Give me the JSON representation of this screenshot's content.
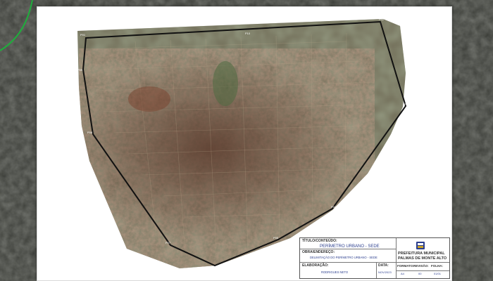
{
  "map": {
    "vertex_labels": [
      "P01",
      "P02",
      "P03",
      "P04",
      "P05",
      "P06",
      "P07",
      "P08",
      "P09",
      "P10"
    ]
  },
  "title_block": {
    "title_label": "TÍTULO/CONTEÚDO:",
    "title_value": "PERÍMETRO URBANO - SEDE",
    "work_label": "OBRA/ENDEREÇO:",
    "work_value": "DELIMITAÇÃO DO PERÍMETRO URBANO - SEDE",
    "prepared_label": "ELABORAÇÃO:",
    "prepared_value": "RODRIGUES NETO",
    "date_label": "DATA:",
    "date_value": "NOV/2023",
    "format_label": "FORMATO:",
    "format_value": "A4",
    "revision_label": "REVISÃO:",
    "revision_value": "00",
    "sheet_label": "FOLHA:",
    "sheet_value": "01/01",
    "org_line1": "PREFEITURA MUNICIPAL",
    "org_line2": "PALMAS DE MONTE ALTO"
  },
  "colors": {
    "perimeter": "#111111",
    "road_overlay": "#1fae3c",
    "title_value": "#2c3f8f"
  },
  "icons": [
    "municipal-coat-of-arms-icon"
  ]
}
